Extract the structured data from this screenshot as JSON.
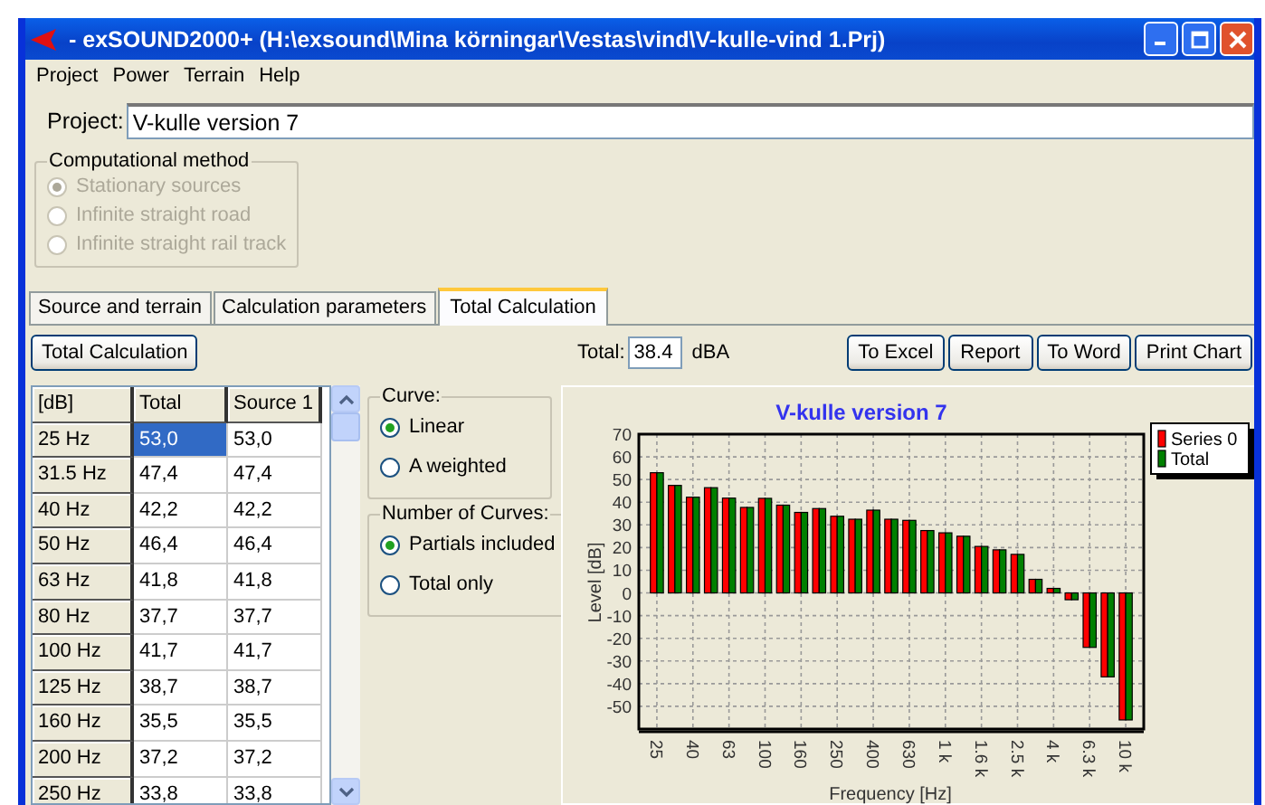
{
  "window": {
    "title": "- exSOUND2000+ (H:\\exsound\\Mina körningar\\Vestas\\vind\\V-kulle-vind 1.Prj)"
  },
  "menu": [
    "Project",
    "Power",
    "Terrain",
    "Help"
  ],
  "project": {
    "label": "Project:",
    "value": "V-kulle version 7"
  },
  "computational_method": {
    "title": "Computational method",
    "disabled": true,
    "options": [
      {
        "label": "Stationary sources",
        "selected": true
      },
      {
        "label": "Infinite straight road",
        "selected": false
      },
      {
        "label": "Infinite straight rail track",
        "selected": false
      }
    ]
  },
  "tabs": [
    {
      "label": "Source and terrain",
      "selected": false
    },
    {
      "label": "Calculation parameters",
      "selected": false
    },
    {
      "label": "Total Calculation",
      "selected": true
    }
  ],
  "toolbar": {
    "calc_button": "Total Calculation",
    "total_label": "Total:",
    "total_value": "38.4",
    "unit": "dBA",
    "buttons": [
      "To Excel",
      "Report",
      "To Word",
      "Print Chart"
    ]
  },
  "table": {
    "columns": [
      "[dB]",
      "Total",
      "Source 1"
    ],
    "rows": [
      {
        "cells": [
          {
            "text": "25 Hz",
            "selected": false
          },
          {
            "text": "53,0",
            "selected": true
          },
          {
            "text": "53,0",
            "selected": false
          }
        ]
      },
      {
        "cells": [
          {
            "text": "31.5 Hz",
            "selected": false
          },
          {
            "text": "47,4",
            "selected": false
          },
          {
            "text": "47,4",
            "selected": false
          }
        ]
      },
      {
        "cells": [
          {
            "text": "40 Hz",
            "selected": false
          },
          {
            "text": "42,2",
            "selected": false
          },
          {
            "text": "42,2",
            "selected": false
          }
        ]
      },
      {
        "cells": [
          {
            "text": "50 Hz",
            "selected": false
          },
          {
            "text": "46,4",
            "selected": false
          },
          {
            "text": "46,4",
            "selected": false
          }
        ]
      },
      {
        "cells": [
          {
            "text": "63 Hz",
            "selected": false
          },
          {
            "text": "41,8",
            "selected": false
          },
          {
            "text": "41,8",
            "selected": false
          }
        ]
      },
      {
        "cells": [
          {
            "text": "80 Hz",
            "selected": false
          },
          {
            "text": "37,7",
            "selected": false
          },
          {
            "text": "37,7",
            "selected": false
          }
        ]
      },
      {
        "cells": [
          {
            "text": "100 Hz",
            "selected": false
          },
          {
            "text": "41,7",
            "selected": false
          },
          {
            "text": "41,7",
            "selected": false
          }
        ]
      },
      {
        "cells": [
          {
            "text": "125 Hz",
            "selected": false
          },
          {
            "text": "38,7",
            "selected": false
          },
          {
            "text": "38,7",
            "selected": false
          }
        ]
      },
      {
        "cells": [
          {
            "text": "160 Hz",
            "selected": false
          },
          {
            "text": "35,5",
            "selected": false
          },
          {
            "text": "35,5",
            "selected": false
          }
        ]
      },
      {
        "cells": [
          {
            "text": "200 Hz",
            "selected": false
          },
          {
            "text": "37,2",
            "selected": false
          },
          {
            "text": "37,2",
            "selected": false
          }
        ]
      },
      {
        "cells": [
          {
            "text": "250 Hz",
            "selected": false
          },
          {
            "text": "33,8",
            "selected": false
          },
          {
            "text": "33,8",
            "selected": false
          }
        ]
      }
    ]
  },
  "curve": {
    "title": "Curve:",
    "options": [
      {
        "label": "Linear",
        "selected": true
      },
      {
        "label": "A weighted",
        "selected": false
      }
    ]
  },
  "number_of_curves": {
    "title": "Number of Curves:",
    "options": [
      {
        "label": "Partials included",
        "selected": true
      },
      {
        "label": "Total only",
        "selected": false
      }
    ]
  },
  "chart": {
    "chart_data": {
      "type": "bar",
      "title": "V-kulle version 7",
      "xlabel": "Frequency [Hz]",
      "ylabel": "Level [dB]",
      "categories": [
        "25",
        null,
        "40",
        null,
        "63",
        null,
        "100",
        null,
        "160",
        null,
        "250",
        null,
        "400",
        null,
        "630",
        null,
        "1 k",
        null,
        "1.6 k",
        null,
        "2.5 k",
        null,
        "4 k",
        null,
        "6.3 k",
        null,
        "10 k"
      ],
      "stacked": false,
      "grid": true,
      "legend": true,
      "series": [
        {
          "name": "Series 0",
          "color": "#ff0000",
          "values": [
            53.0,
            47.4,
            42.2,
            46.4,
            41.8,
            37.7,
            41.7,
            38.7,
            35.5,
            37.2,
            33.8,
            32.5,
            36.5,
            32.5,
            32,
            27.5,
            26.5,
            25,
            20.5,
            19,
            17,
            6,
            2,
            -3,
            -24,
            -37,
            -56
          ]
        },
        {
          "name": "Total",
          "color": "#008000",
          "values": [
            53.0,
            47.4,
            42.2,
            46.4,
            41.8,
            37.7,
            41.7,
            38.7,
            35.5,
            37.2,
            33.8,
            32.5,
            36.5,
            32.5,
            32,
            27.5,
            26.5,
            25,
            20.5,
            19,
            17,
            6,
            2,
            -3,
            -24,
            -37,
            -56
          ]
        }
      ],
      "ylim": [
        -60,
        70
      ],
      "yticks": [
        -50,
        -40,
        -30,
        -20,
        -10,
        0,
        10,
        20,
        30,
        40,
        50,
        60,
        70
      ]
    }
  }
}
